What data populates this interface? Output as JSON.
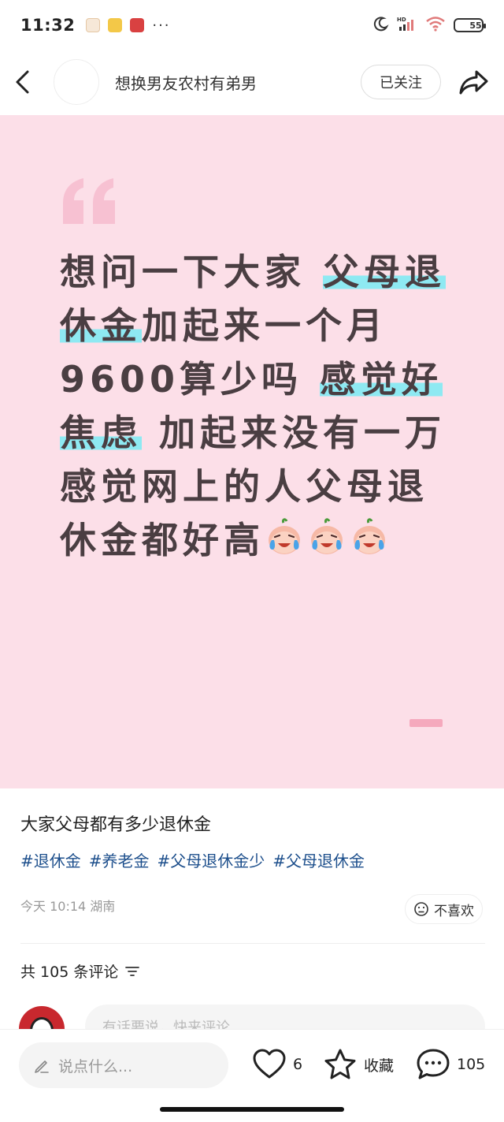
{
  "status_bar": {
    "time": "11:32",
    "more": "···",
    "battery": "55",
    "battery_level": 0.55
  },
  "header": {
    "author": "想换男友农村有弟男",
    "follow_label": "已关注"
  },
  "card": {
    "segments": [
      {
        "text": "想问一下大家 ",
        "hl": false
      },
      {
        "text": "父母退休金",
        "hl": true
      },
      {
        "text": "加起来一个月9600算少吗 ",
        "hl": false
      },
      {
        "text": "感觉好焦虑",
        "hl": true
      },
      {
        "text": " 加起来没有一万 感觉网上的人父母退休金都好高",
        "hl": false
      }
    ],
    "emoji_count": 3,
    "emoji_name": "crying-laughing-emoji"
  },
  "post": {
    "title": "大家父母都有多少退休金",
    "tags": [
      "#退休金",
      "#养老金",
      "#父母退休金少",
      "#父母退休金"
    ],
    "date": "今天 10:14",
    "location": "湖南",
    "dislike_label": "不喜欢",
    "comment_count_label": "共 105 条评论",
    "comment_placeholder": "有话要说，快来评论"
  },
  "bottom_bar": {
    "input_placeholder": "说点什么...",
    "likes": "6",
    "collect_label": "收藏",
    "comments": "105"
  },
  "colors": {
    "card_bg": "#fcdfe8",
    "highlight": "#8ee9f2",
    "tag": "#1d4f8c",
    "card_text": "#4a3e42"
  }
}
